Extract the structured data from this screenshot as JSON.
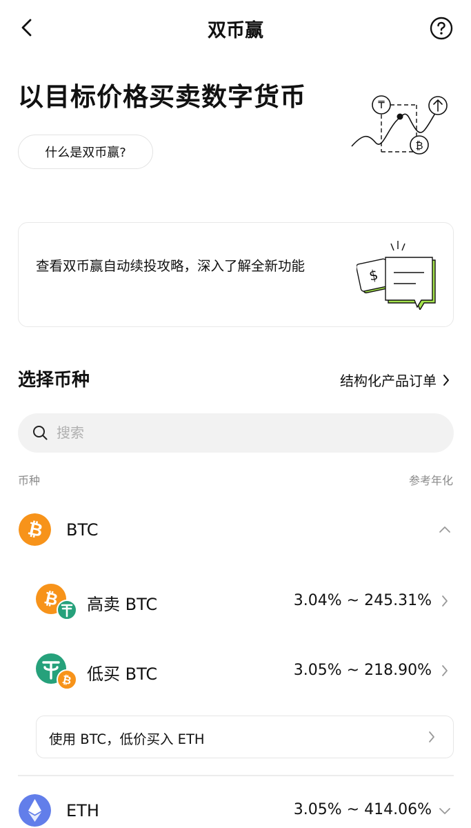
{
  "header": {
    "title": "双币赢"
  },
  "hero": {
    "title": "以目标价格买卖数字货币",
    "what_button": "什么是双币赢?"
  },
  "promo": {
    "text": "查看双币赢自动续投攻略，深入了解全新功能"
  },
  "section": {
    "title": "选择币种",
    "orders_link": "结构化产品订单"
  },
  "search": {
    "placeholder": "搜索",
    "value": ""
  },
  "columns": {
    "left": "币种",
    "right": "参考年化"
  },
  "coins": [
    {
      "symbol": "BTC",
      "expanded": true,
      "icon": "bitcoin-icon",
      "color": "#f7931a",
      "products": [
        {
          "label": "高卖 BTC",
          "apy": "3.04% ~ 245.31%",
          "icon": "btc-usdt-pair-icon"
        },
        {
          "label": "低买 BTC",
          "apy": "3.05% ~ 218.90%",
          "icon": "usdt-btc-pair-icon"
        }
      ],
      "switch_card": "使用 BTC，低价买入 ETH"
    },
    {
      "symbol": "ETH",
      "expanded": false,
      "icon": "ethereum-icon",
      "color": "#627eea",
      "apy": "3.05% ~ 414.06%"
    }
  ],
  "colors": {
    "btc": "#f7931a",
    "usdt": "#26a17b",
    "eth": "#627eea",
    "accent_green": "#a4e34c"
  }
}
